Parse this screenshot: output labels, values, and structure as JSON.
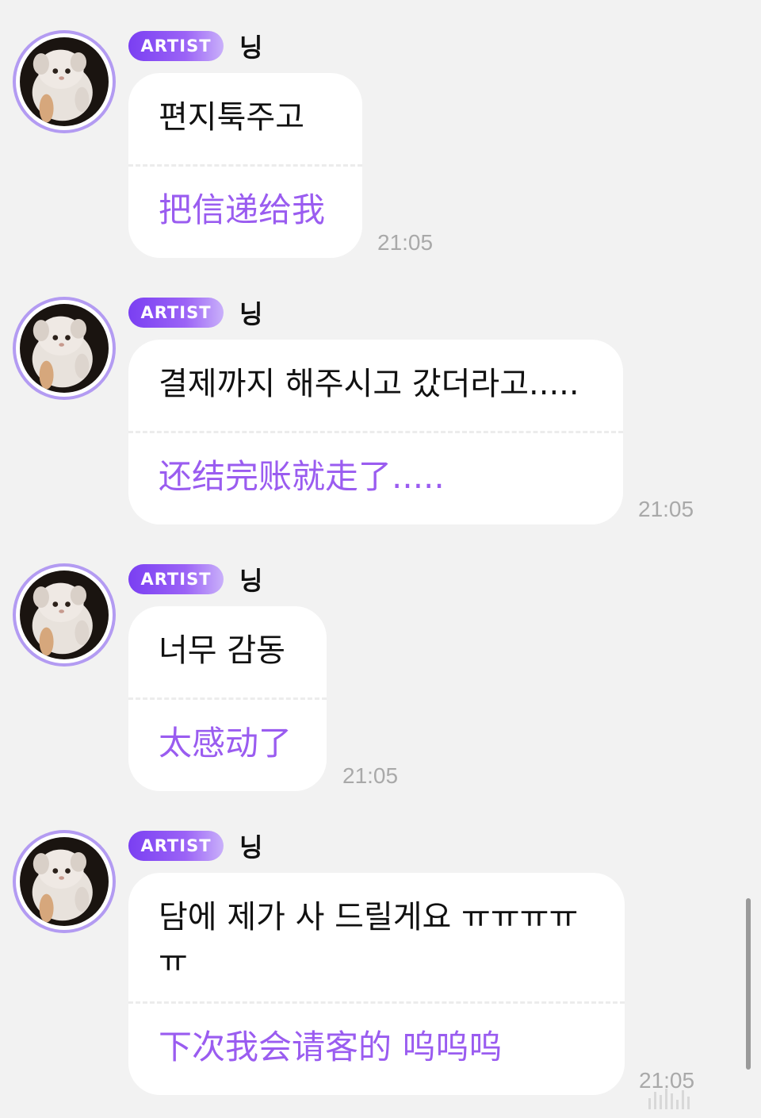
{
  "messages": [
    {
      "badge": "ARTIST",
      "sender": "닝",
      "original": "편지툭주고",
      "translation": "把信递给我",
      "time": "21:05"
    },
    {
      "badge": "ARTIST",
      "sender": "닝",
      "original": "결제까지 해주시고 갔더라고.....",
      "translation": "还结完账就走了.....",
      "time": "21:05"
    },
    {
      "badge": "ARTIST",
      "sender": "닝",
      "original": "너무 감동",
      "translation": "太感动了",
      "time": "21:05"
    },
    {
      "badge": "ARTIST",
      "sender": "닝",
      "original": "담에 제가 사 드릴게요 ㅠㅠㅠㅠ\nㅠ",
      "translation": "下次我会请客的 呜呜呜",
      "time": "21:05"
    }
  ],
  "colors": {
    "background": "#f2f2f2",
    "bubble": "#ffffff",
    "translation_text": "#9a5cf0",
    "badge_gradient_start": "#7a3ff2",
    "badge_gradient_end": "#c9b0fa",
    "avatar_ring": "#b39bf2",
    "timestamp": "#a9a9a9"
  },
  "icons": {
    "avatar": "white-fluffy-cat-photo"
  }
}
